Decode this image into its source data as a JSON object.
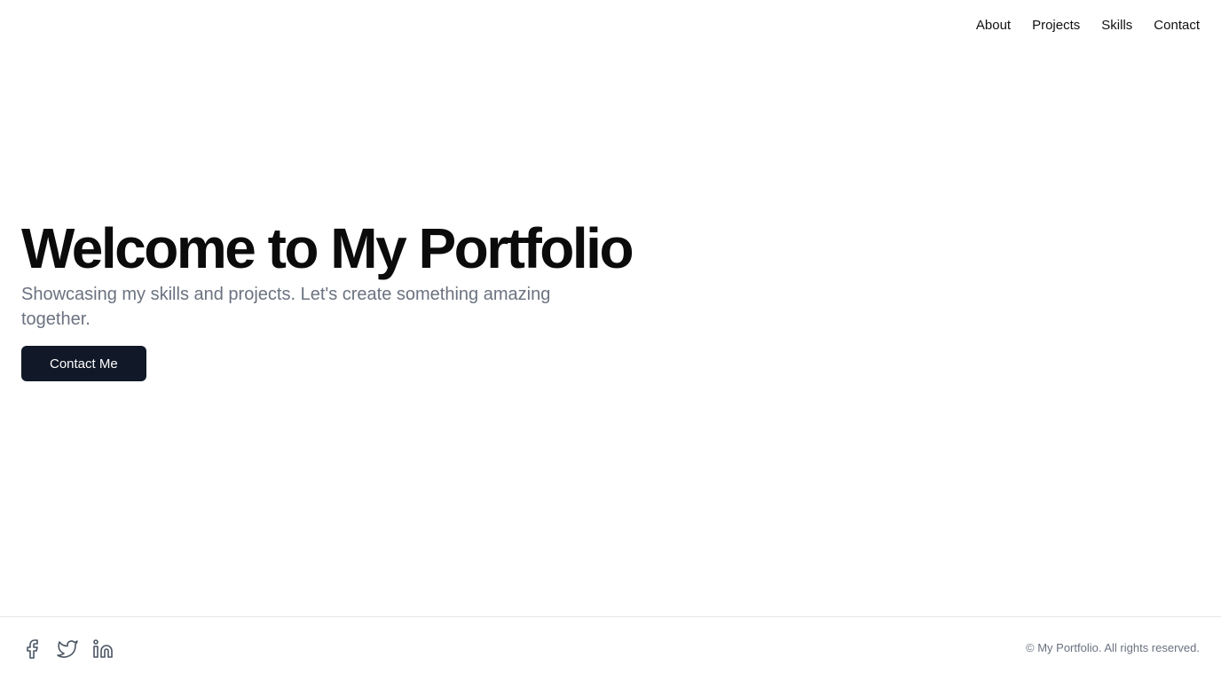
{
  "nav": {
    "items": [
      {
        "label": "About"
      },
      {
        "label": "Projects"
      },
      {
        "label": "Skills"
      },
      {
        "label": "Contact"
      }
    ]
  },
  "hero": {
    "title": "Welcome to My Portfolio",
    "subtitle": "Showcasing my skills and projects. Let's create something amazing together.",
    "cta_label": "Contact Me"
  },
  "footer": {
    "social_icons": [
      "facebook-icon",
      "twitter-icon",
      "linkedin-icon"
    ],
    "copyright": "© My Portfolio. All rights reserved."
  },
  "colors": {
    "primary_button": "#111827",
    "muted_text": "#6b7280",
    "border": "#e5e7eb"
  }
}
